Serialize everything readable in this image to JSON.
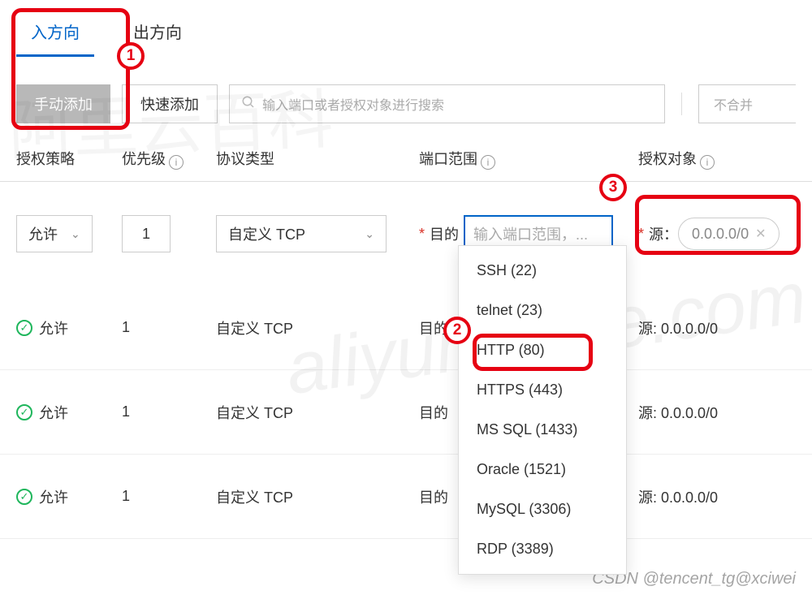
{
  "tabs": {
    "in": "入方向",
    "out": "出方向"
  },
  "toolbar": {
    "manual_add": "手动添加",
    "quick_add": "快速添加",
    "search_placeholder": "输入端口或者授权对象进行搜索",
    "merge": "不合并"
  },
  "headers": {
    "policy": "授权策略",
    "priority": "优先级",
    "protocol": "协议类型",
    "port_range": "端口范围",
    "target": "授权对象"
  },
  "edit_row": {
    "policy": "允许",
    "priority": "1",
    "protocol": "自定义 TCP",
    "port_label_prefix": "目的",
    "port_placeholder": "输入端口范围，...",
    "source_label": "源：",
    "source_chip": "0.0.0.0/0"
  },
  "dropdown": {
    "items": [
      "SSH (22)",
      "telnet (23)",
      "HTTP (80)",
      "HTTPS (443)",
      "MS SQL (1433)",
      "Oracle (1521)",
      "MySQL (3306)",
      "RDP (3389)"
    ]
  },
  "rows": [
    {
      "policy": "允许",
      "priority": "1",
      "protocol": "自定义 TCP",
      "port_label": "目的",
      "source": "源: 0.0.0.0/0"
    },
    {
      "policy": "允许",
      "priority": "1",
      "protocol": "自定义 TCP",
      "port_label": "目的",
      "source": "源: 0.0.0.0/0"
    },
    {
      "policy": "允许",
      "priority": "1",
      "protocol": "自定义 TCP",
      "port_label": "目的",
      "source": "源: 0.0.0.0/0"
    }
  ],
  "annotations": {
    "n1": "1",
    "n2": "2",
    "n3": "3"
  },
  "footer": "CSDN @tencent_tg@xciwei"
}
